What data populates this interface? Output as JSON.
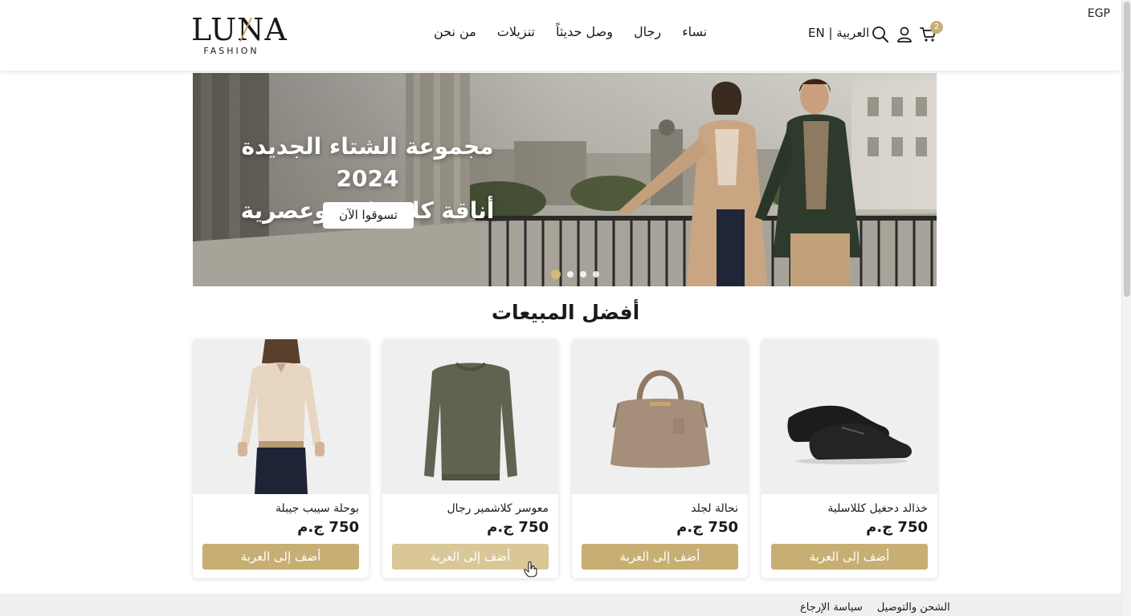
{
  "header": {
    "currency": "EGP",
    "logo": {
      "brand": "LUNA",
      "sub": "FASHION"
    },
    "nav": [
      "نساء",
      "رجال",
      "وصل حديثاً",
      "تنزيلات",
      "من نحن"
    ],
    "language": "العربية | EN",
    "cart_count": "2",
    "icons": [
      "search-icon",
      "user-icon",
      "cart-icon"
    ]
  },
  "hero": {
    "title_line1": "مجموعة الشتاء الجديدة 2024",
    "title_line2": "أناقة كلاسيكية وعصرية",
    "cta": "تسوقوا الآن",
    "slides_total": 4,
    "active_slide": 1
  },
  "bestsellers": {
    "title": "أفضل المبيعات",
    "products": [
      {
        "name": "بوحلة سيبب جيبلة",
        "price": "750 ج.م",
        "button": "أضف إلى العربة"
      },
      {
        "name": "معوسر كلاشمير رجال",
        "price": "750 ج.م",
        "button": "أضف إلى العربة"
      },
      {
        "name": "نحالة لجلد",
        "price": "750 ج.م",
        "button": "أضف إلى العربة"
      },
      {
        "name": "خذالد دحغيل كللاسلية",
        "price": "750 ج.م",
        "button": "أضف إلى العربة"
      }
    ]
  },
  "footer": {
    "links": [
      "الشحن والتوصيل",
      "سياسة الإرجاع"
    ]
  },
  "colors": {
    "accent": "#c7ae73",
    "accent_hover": "#d9c798",
    "text": "#1a1a1a"
  }
}
